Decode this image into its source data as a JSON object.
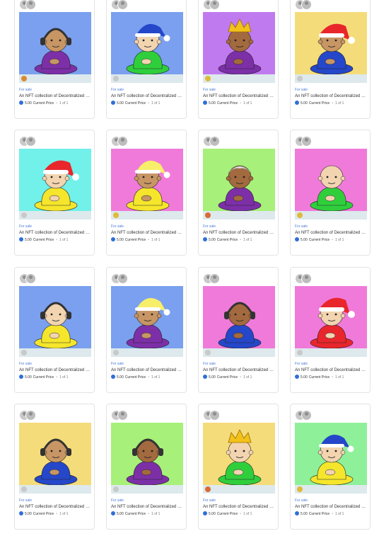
{
  "gallery": {
    "cards": [
      {
        "status": "For sale",
        "title": "An NFT collection of Decentralized Humans",
        "price": "5.00",
        "price_label": "Current Price",
        "edition": "1 of 1",
        "bg": "#7aa0ef",
        "skin": "#c79664",
        "shirt": "#7d2fa8",
        "hat": "headphones",
        "chip": "#d98a36"
      },
      {
        "status": "For sale",
        "title": "An NFT collection of Decentralized Humans",
        "price": "5.00",
        "price_label": "Current Price",
        "edition": "1 of 1",
        "bg": "#7aa0ef",
        "skin": "#f2d4b0",
        "shirt": "#2fcf3c",
        "hat": "beanie-blue",
        "chip": "#c9c9c9"
      },
      {
        "status": "For sale",
        "title": "An NFT collection of Decentralized Humans",
        "price": "5.00",
        "price_label": "Current Price",
        "edition": "1 of 1",
        "bg": "#c07af0",
        "skin": "#a36a3f",
        "shirt": "#7d2fa8",
        "hat": "crown",
        "chip": "#e0b93a"
      },
      {
        "status": "For sale",
        "title": "An NFT collection of Decentralized Humans",
        "price": "5.00",
        "price_label": "Current Price",
        "edition": "1 of 1",
        "bg": "#f5dc7a",
        "skin": "#c79664",
        "shirt": "#2547c9",
        "hat": "santa",
        "chip": "#c9c9c9"
      },
      {
        "status": "For sale",
        "title": "An NFT collection of Decentralized Humans",
        "price": "5.00",
        "price_label": "Current Price",
        "edition": "1 of 1",
        "bg": "#72f0ea",
        "skin": "#f2d4b0",
        "shirt": "#f5e62c",
        "hat": "santa",
        "chip": "#c9c9c9"
      },
      {
        "status": "For sale",
        "title": "An NFT collection of Decentralized Humans",
        "price": "5.00",
        "price_label": "Current Price",
        "edition": "1 of 1",
        "bg": "#f07ad9",
        "skin": "#c79664",
        "shirt": "#f5e62c",
        "hat": "beanie-yellow",
        "chip": "#e0b93a"
      },
      {
        "status": "For sale",
        "title": "An NFT collection of Decentralized Humans",
        "price": "5.00",
        "price_label": "Current Price",
        "edition": "1 of 1",
        "bg": "#a7f07a",
        "skin": "#a36a3f",
        "shirt": "#7d2fa8",
        "hat": "white-hair",
        "chip": "#d96a36"
      },
      {
        "status": "For sale",
        "title": "An NFT collection of Decentralized Humans",
        "price": "5.00",
        "price_label": "Current Price",
        "edition": "1 of 1",
        "bg": "#f07ad9",
        "skin": "#f2d4b0",
        "shirt": "#2fcf3c",
        "hat": "none",
        "chip": "#e0b93a"
      },
      {
        "status": "For sale",
        "title": "An NFT collection of Decentralized Humans",
        "price": "5.00",
        "price_label": "Current Price",
        "edition": "1 of 1",
        "bg": "#7aa0ef",
        "skin": "#f2d4b0",
        "shirt": "#f5e62c",
        "hat": "headphones",
        "chip": "#c9c9c9"
      },
      {
        "status": "For sale",
        "title": "An NFT collection of Decentralized Humans",
        "price": "5.00",
        "price_label": "Current Price",
        "edition": "1 of 1",
        "bg": "#7aa0ef",
        "skin": "#c79664",
        "shirt": "#7d2fa8",
        "hat": "beanie-yellow",
        "chip": "#c9c9c9"
      },
      {
        "status": "For sale",
        "title": "An NFT collection of Decentralized Humans",
        "price": "5.00",
        "price_label": "Current Price",
        "edition": "1 of 1",
        "bg": "#f07ad9",
        "skin": "#a36a3f",
        "shirt": "#2547c9",
        "hat": "headphones",
        "chip": "#c9c9c9"
      },
      {
        "status": "For sale",
        "title": "An NFT collection of Decentralized Humans",
        "price": "5.00",
        "price_label": "Current Price",
        "edition": "1 of 1",
        "bg": "#f07ad9",
        "skin": "#f2d4b0",
        "shirt": "#e8262c",
        "hat": "santa",
        "chip": "#c9c9c9"
      },
      {
        "status": "For sale",
        "title": "An NFT collection of Decentralized Humans",
        "price": "5.00",
        "price_label": "Current Price",
        "edition": "1 of 1",
        "bg": "#f5dc7a",
        "skin": "#c79664",
        "shirt": "#2547c9",
        "hat": "headphones",
        "chip": "#c9c9c9"
      },
      {
        "status": "For sale",
        "title": "An NFT collection of Decentralized Humans",
        "price": "5.00",
        "price_label": "Current Price",
        "edition": "1 of 1",
        "bg": "#a7f07a",
        "skin": "#a36a3f",
        "shirt": "#7d2fa8",
        "hat": "headphones",
        "chip": "#c9c9c9"
      },
      {
        "status": "For sale",
        "title": "An NFT collection of Decentralized Humans",
        "price": "5.00",
        "price_label": "Current Price",
        "edition": "1 of 1",
        "bg": "#f5dc7a",
        "skin": "#f2d4b0",
        "shirt": "#2fcf3c",
        "hat": "crown",
        "chip": "#d96a36"
      },
      {
        "status": "For sale",
        "title": "An NFT collection of Decentralized Humans",
        "price": "5.00",
        "price_label": "Current Price",
        "edition": "1 of 1",
        "bg": "#8ff09a",
        "skin": "#f2d4b0",
        "shirt": "#f5e62c",
        "hat": "beanie-blue",
        "chip": "#e0b93a"
      }
    ]
  }
}
